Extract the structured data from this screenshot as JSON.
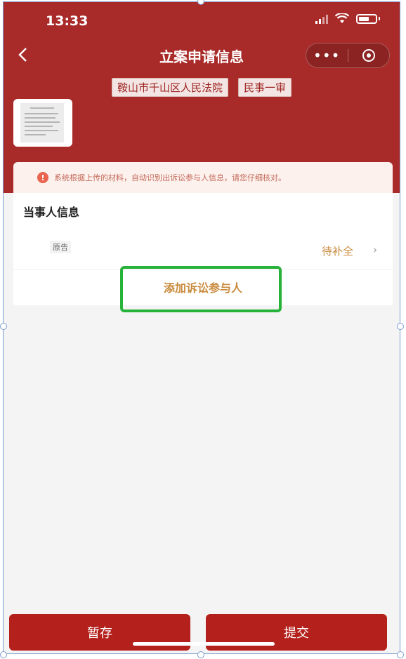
{
  "status_bar": {
    "time": "13:33"
  },
  "nav": {
    "title": "立案申请信息",
    "more_label": "•••"
  },
  "tags": [
    "鞍山市千山区人民法院",
    "民事一审"
  ],
  "notice": {
    "text": "系统根据上传的材料，自动识别出诉讼参与人信息，请您仔细核对。"
  },
  "party_section": {
    "title": "当事人信息",
    "party_role": "原告",
    "party_status": "待补全",
    "chevron": "›",
    "add_label": "添加诉讼参与人"
  },
  "buttons": {
    "save": "暂存",
    "submit": "提交"
  },
  "colors": {
    "brand": "#a92b29",
    "button": "#b4211d",
    "accent": "#c98a3c",
    "highlight": "#27b23a",
    "notice_bg": "#fdf1ee"
  }
}
